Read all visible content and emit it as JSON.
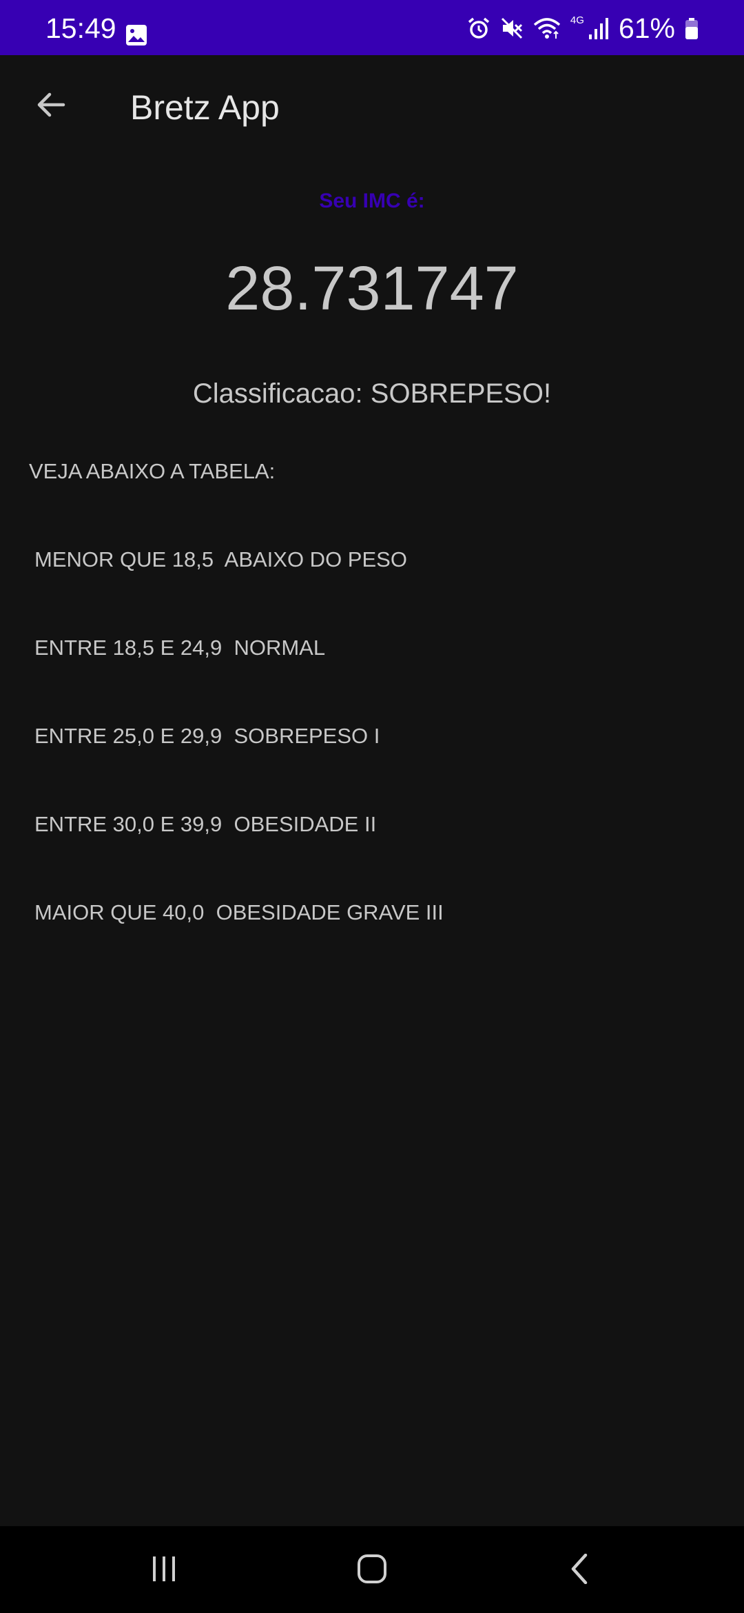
{
  "status_bar": {
    "time": "15:49",
    "network_type": "4G",
    "battery_percent": "61%",
    "background_color": "#3700b3",
    "icons": [
      "gallery-icon",
      "alarm-icon",
      "mute-icon",
      "wifi-icon",
      "signal-icon",
      "battery-icon"
    ]
  },
  "app_bar": {
    "title": "Bretz App",
    "back_icon": "arrow-back-icon"
  },
  "result": {
    "label": "Seu IMC é:",
    "value": "28.731747",
    "classification": "Classificacao: SOBREPESO!"
  },
  "table": {
    "heading": "VEJA ABAIXO A TABELA:",
    "rows": [
      "MENOR QUE 18,5  ABAIXO DO PESO",
      "ENTRE 18,5 E 24,9  NORMAL",
      "ENTRE 25,0 E 29,9  SOBREPESO I",
      "ENTRE 30,0 E 39,9  OBESIDADE II",
      "MAIOR QUE 40,0  OBESIDADE GRAVE III"
    ]
  },
  "nav_bar": {
    "icons": [
      "recent-apps-icon",
      "home-icon",
      "back-nav-icon"
    ]
  },
  "colors": {
    "accent": "#3700b3",
    "background": "#121212",
    "text": "#c8c8c8"
  }
}
